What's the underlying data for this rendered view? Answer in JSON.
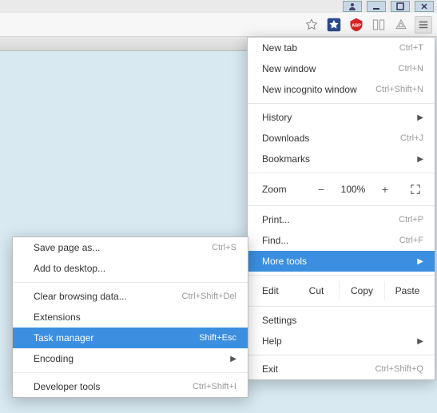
{
  "titlebar": {
    "user": "user",
    "minimize": "minimize",
    "maximize": "maximize",
    "close": "close"
  },
  "toolbar": {
    "star": "bookmark-star",
    "ext_bluestar": "blue-star-extension",
    "ext_abp": "ABP",
    "ext_gray1": "extension",
    "ext_gray2": "extension",
    "menu": "menu"
  },
  "menu": {
    "new_tab": {
      "label": "New tab",
      "shortcut": "Ctrl+T"
    },
    "new_window": {
      "label": "New window",
      "shortcut": "Ctrl+N"
    },
    "new_incognito": {
      "label": "New incognito window",
      "shortcut": "Ctrl+Shift+N"
    },
    "history": {
      "label": "History"
    },
    "downloads": {
      "label": "Downloads",
      "shortcut": "Ctrl+J"
    },
    "bookmarks": {
      "label": "Bookmarks"
    },
    "zoom": {
      "label": "Zoom",
      "minus": "−",
      "value": "100%",
      "plus": "+"
    },
    "print": {
      "label": "Print...",
      "shortcut": "Ctrl+P"
    },
    "find": {
      "label": "Find...",
      "shortcut": "Ctrl+F"
    },
    "more_tools": {
      "label": "More tools"
    },
    "edit": {
      "label": "Edit",
      "cut": "Cut",
      "copy": "Copy",
      "paste": "Paste"
    },
    "settings": {
      "label": "Settings"
    },
    "help": {
      "label": "Help"
    },
    "exit": {
      "label": "Exit",
      "shortcut": "Ctrl+Shift+Q"
    }
  },
  "submenu": {
    "save_page": {
      "label": "Save page as...",
      "shortcut": "Ctrl+S"
    },
    "add_to_desktop": {
      "label": "Add to desktop..."
    },
    "clear_browsing": {
      "label": "Clear browsing data...",
      "shortcut": "Ctrl+Shift+Del"
    },
    "extensions": {
      "label": "Extensions"
    },
    "task_manager": {
      "label": "Task manager",
      "shortcut": "Shift+Esc"
    },
    "encoding": {
      "label": "Encoding"
    },
    "dev_tools": {
      "label": "Developer tools",
      "shortcut": "Ctrl+Shift+I"
    }
  }
}
